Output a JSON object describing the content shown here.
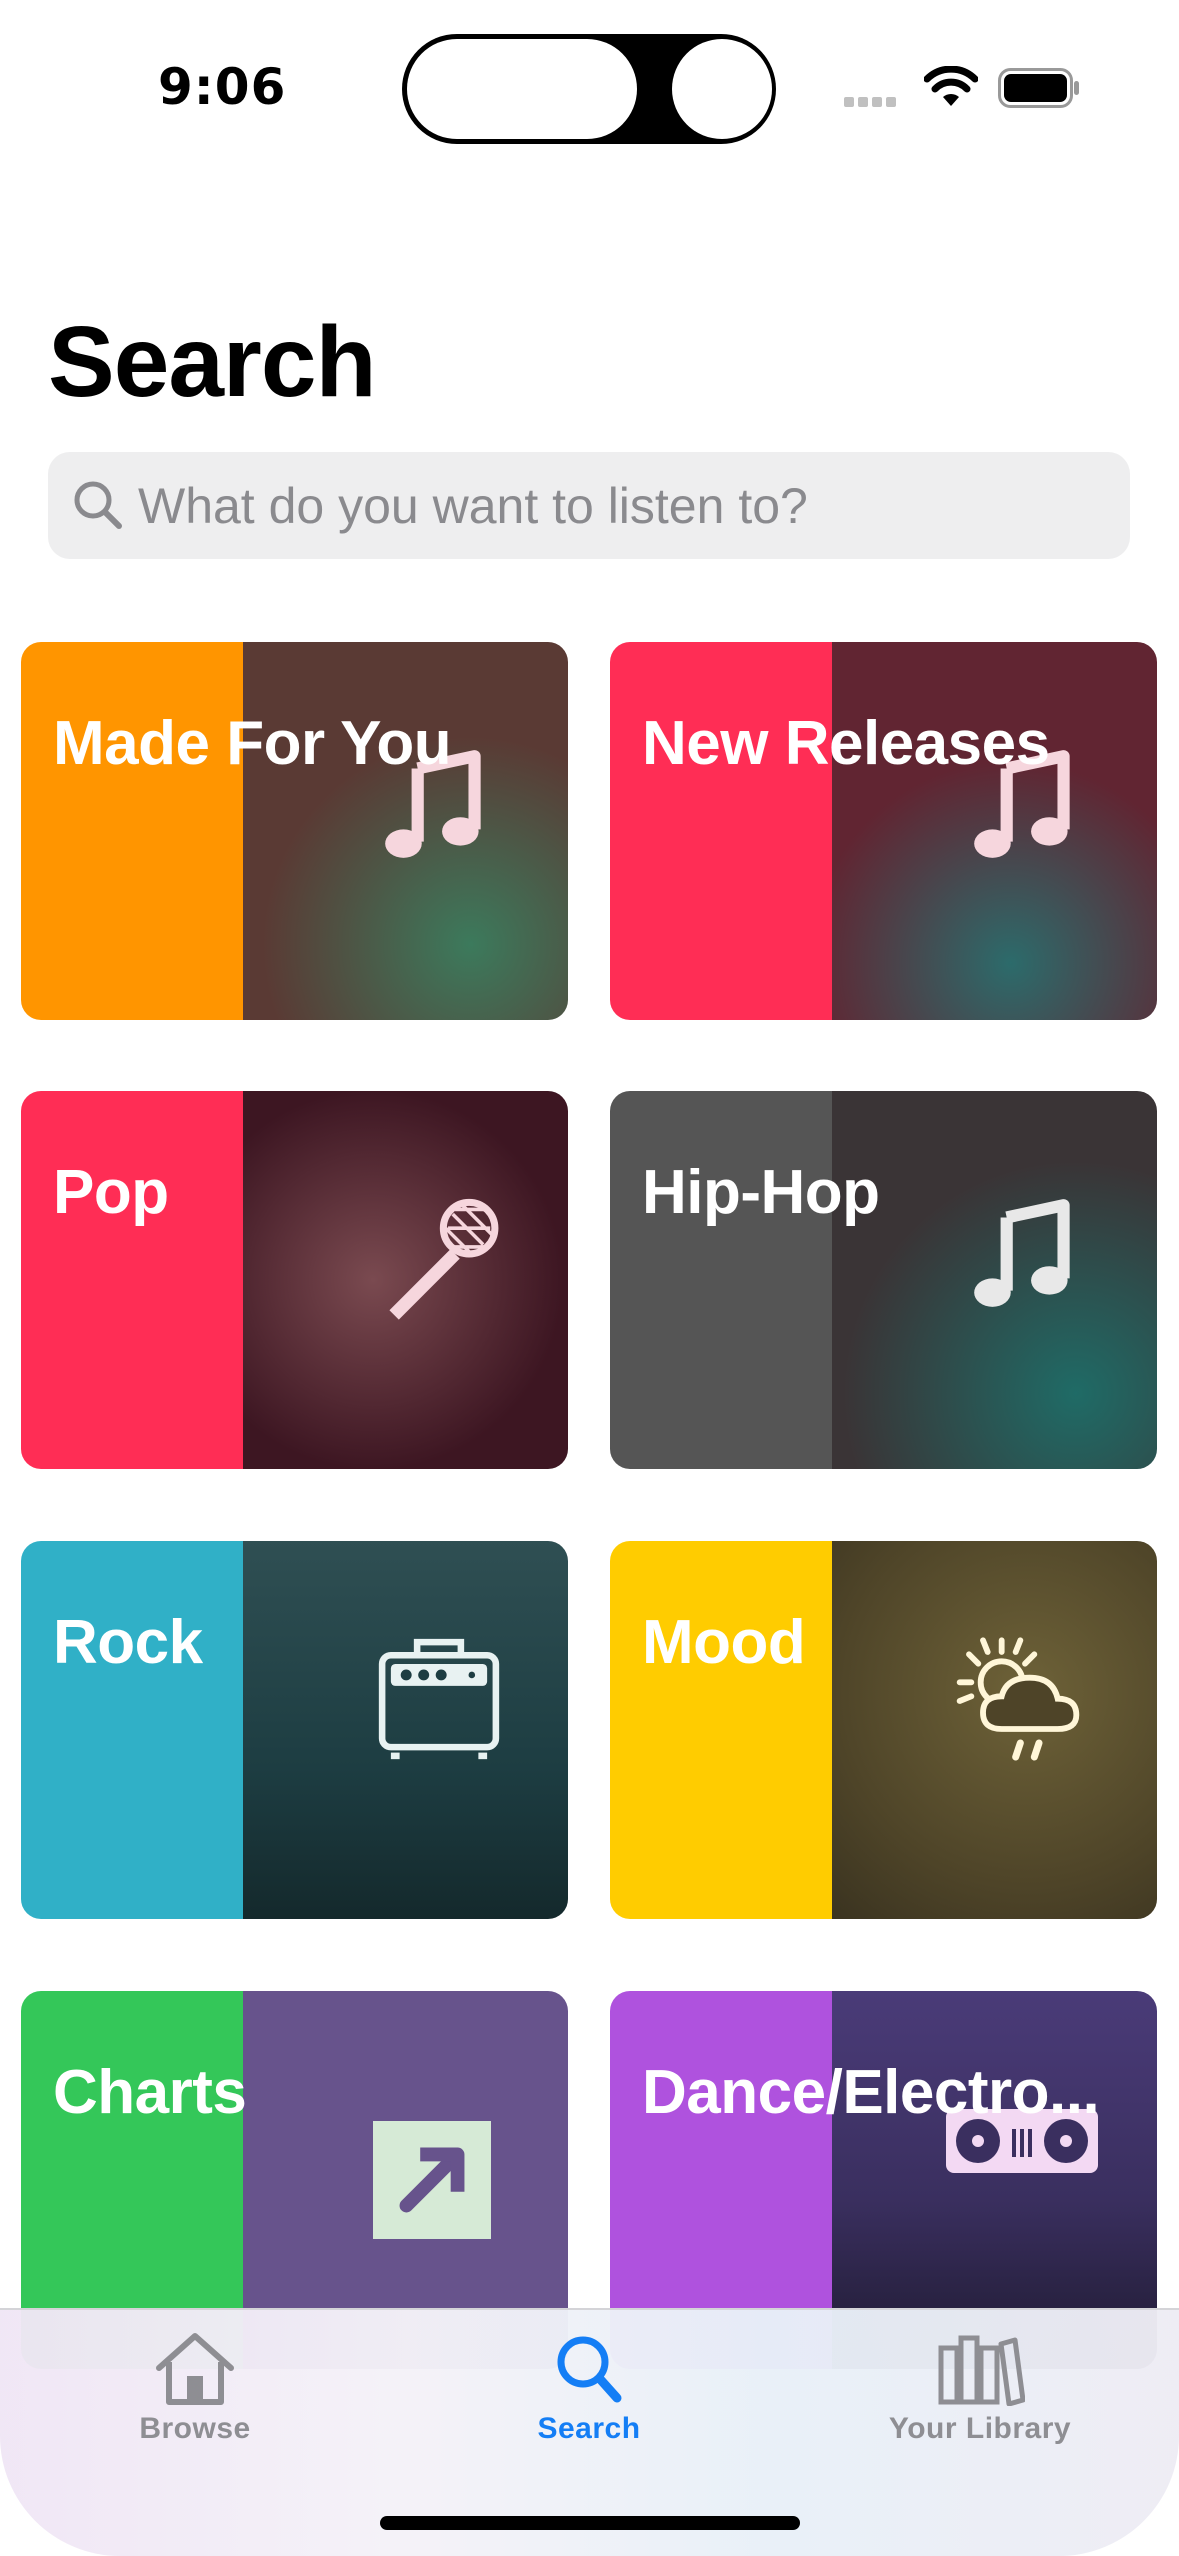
{
  "status_bar": {
    "time": "9:06"
  },
  "page": {
    "title": "Search"
  },
  "search": {
    "placeholder": "What do you want to listen to?"
  },
  "categories": [
    {
      "label": "Made For You",
      "color": "#ff9500",
      "art_color": "#5a3a34",
      "icon": "music-note-icon"
    },
    {
      "label": "New Releases",
      "color": "#ff2d55",
      "art_color": "#612532",
      "icon": "music-note-icon"
    },
    {
      "label": "Pop",
      "color": "#ff2d55",
      "art_color": "#3d1622",
      "icon": "microphone-icon"
    },
    {
      "label": "Hip-Hop",
      "color": "#555555",
      "art_color": "#3a3436",
      "icon": "music-note-icon"
    },
    {
      "label": "Rock",
      "color": "#30b0c7",
      "art_color": "#1d3d42",
      "icon": "amplifier-icon"
    },
    {
      "label": "Mood",
      "color": "#ffcc00",
      "art_color": "#4e4428",
      "icon": "sun-cloud-rain-icon"
    },
    {
      "label": "Charts",
      "color": "#34c759",
      "art_color": "#67538c",
      "icon": "trending-arrow-icon"
    },
    {
      "label": "Dance/Electro...",
      "color": "#af52de",
      "art_color": "#3a2f5f",
      "icon": "turntable-icon"
    }
  ],
  "tab_bar": {
    "tabs": [
      {
        "label": "Browse",
        "icon": "house-icon",
        "active": false
      },
      {
        "label": "Search",
        "icon": "magnifier-icon",
        "active": true
      },
      {
        "label": "Your Library",
        "icon": "library-books-icon",
        "active": false
      }
    ],
    "active_color": "#147ef5",
    "inactive_color": "#8e8e93"
  }
}
